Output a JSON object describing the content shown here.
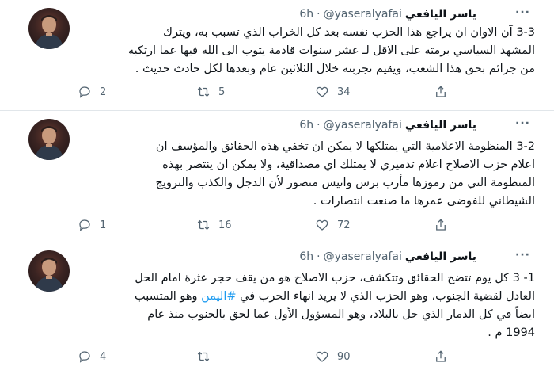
{
  "tweets": [
    {
      "author": "ياسر اليافعي",
      "handle": "@yaseralyafai",
      "separator": "·",
      "time": "6h",
      "more": "···",
      "lines": [
        "3-3  آن الاوان ان يراجع هذا الحزب نفسه بعد كل الخراب الذي تسبب به، ويترك",
        "المشهد السياسي برمته على الاقل لـ عشر سنوات قادمة يتوب الى الله فيها عما ارتكبه",
        "من جرائم بحق هذا الشعب، ويقيم تجربته خلال الثلاثين عام وبعدها لكل حادث حديث ."
      ],
      "replies": "2",
      "retweets": "5",
      "likes": "34"
    },
    {
      "author": "ياسر اليافعي",
      "handle": "@yaseralyafai",
      "separator": "·",
      "time": "6h",
      "more": "···",
      "lines": [
        "3-2 المنظومة الاعلامية التي يمتلكها لا يمكن ان تخفي هذه الحقائق والمؤسف ان",
        "اعلام حزب الاصلاح اعلام تدميري لا يمتلك اي مصداقية، ولا يمكن ان ينتصر بهذه",
        "المنظومة التي من رموزها مأرب برس وانيس منصور لأن الدجل والكذب والترويج",
        "الشيطاني للفوضى عمرها ما صنعت انتصارات ."
      ],
      "replies": "1",
      "retweets": "16",
      "likes": "72"
    },
    {
      "author": "ياسر اليافعي",
      "handle": "@yaseralyafai",
      "separator": "·",
      "time": "6h",
      "more": "···",
      "lines_pre": [
        "1- 3 كل يوم تتضح الحقائق وتتكشف، حزب الاصلاح هو من يقف حجر عثرة امام الحل"
      ],
      "line_hashtag_pre": "العادل لقضية الجنوب، وهو الحزب الذي لا يريد انهاء الحرب في ",
      "hashtag": "#اليمن",
      "line_hashtag_post": " وهو المتسبب",
      "lines_post": [
        "ايضاً في كل الدمار الذي حل بالبلاد، وهو المسؤول الأول عما لحق بالجنوب منذ عام",
        "1994 م ."
      ],
      "replies": "4",
      "retweets": "",
      "likes": "90"
    }
  ],
  "icons": {
    "reply": "reply-icon",
    "retweet": "retweet-icon",
    "like": "like-icon",
    "share": "share-icon"
  },
  "colors": {
    "link": "#1d9bf0",
    "muted": "#536471",
    "text": "#0f1419",
    "divider": "#e1e6ea"
  }
}
